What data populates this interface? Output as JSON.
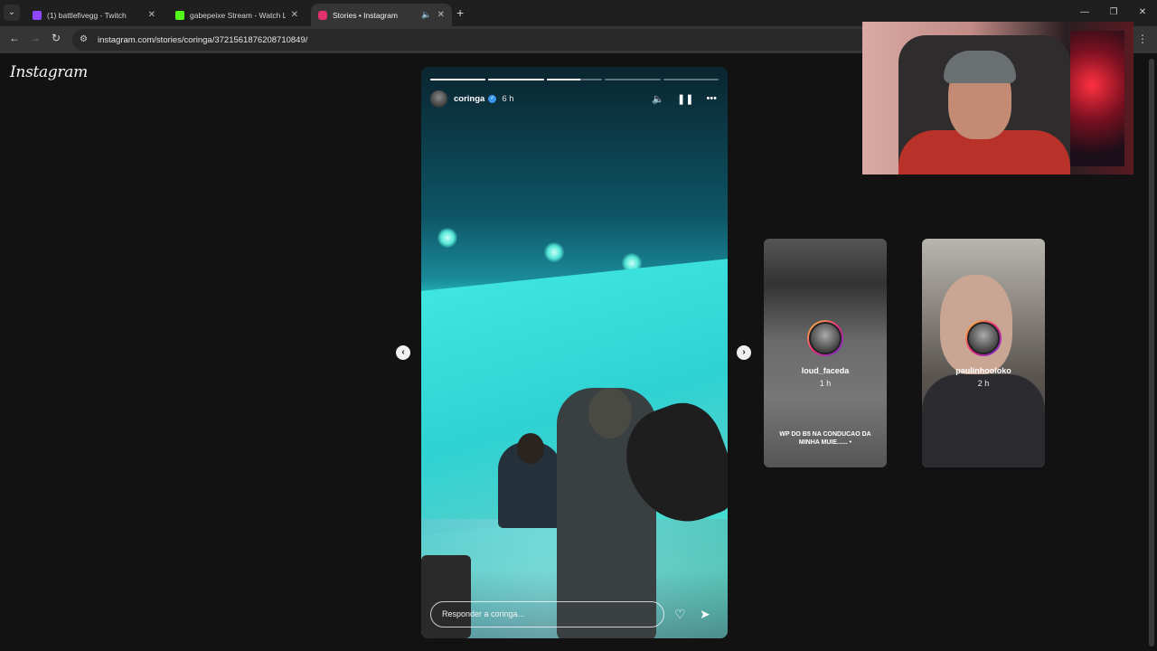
{
  "browser": {
    "tabs": [
      {
        "title": "(1) battlefivegg - Twitch",
        "favicon_color": "#9146ff"
      },
      {
        "title": "gabepeixe Stream - Watch Live",
        "favicon_color": "#53fc18"
      },
      {
        "title": "Stories • Instagram",
        "favicon_color": "#e1306c"
      }
    ],
    "url": "instagram.com/stories/coringa/3721561876208710849/"
  },
  "page": {
    "logo": "Instagram",
    "story": {
      "username": "coringa",
      "time": "6 h",
      "reply_placeholder": "Responder a coringa...",
      "segments": 5,
      "current_segment": 3,
      "current_progress": 0.6
    },
    "next_stories": [
      {
        "username": "loud_faceda",
        "time": "1 h",
        "caption": "WP DO B5 NA CONDUCAO DA MINHA MUIE...... •"
      },
      {
        "username": "paulinhooloko",
        "time": "2 h",
        "caption": ""
      }
    ]
  }
}
